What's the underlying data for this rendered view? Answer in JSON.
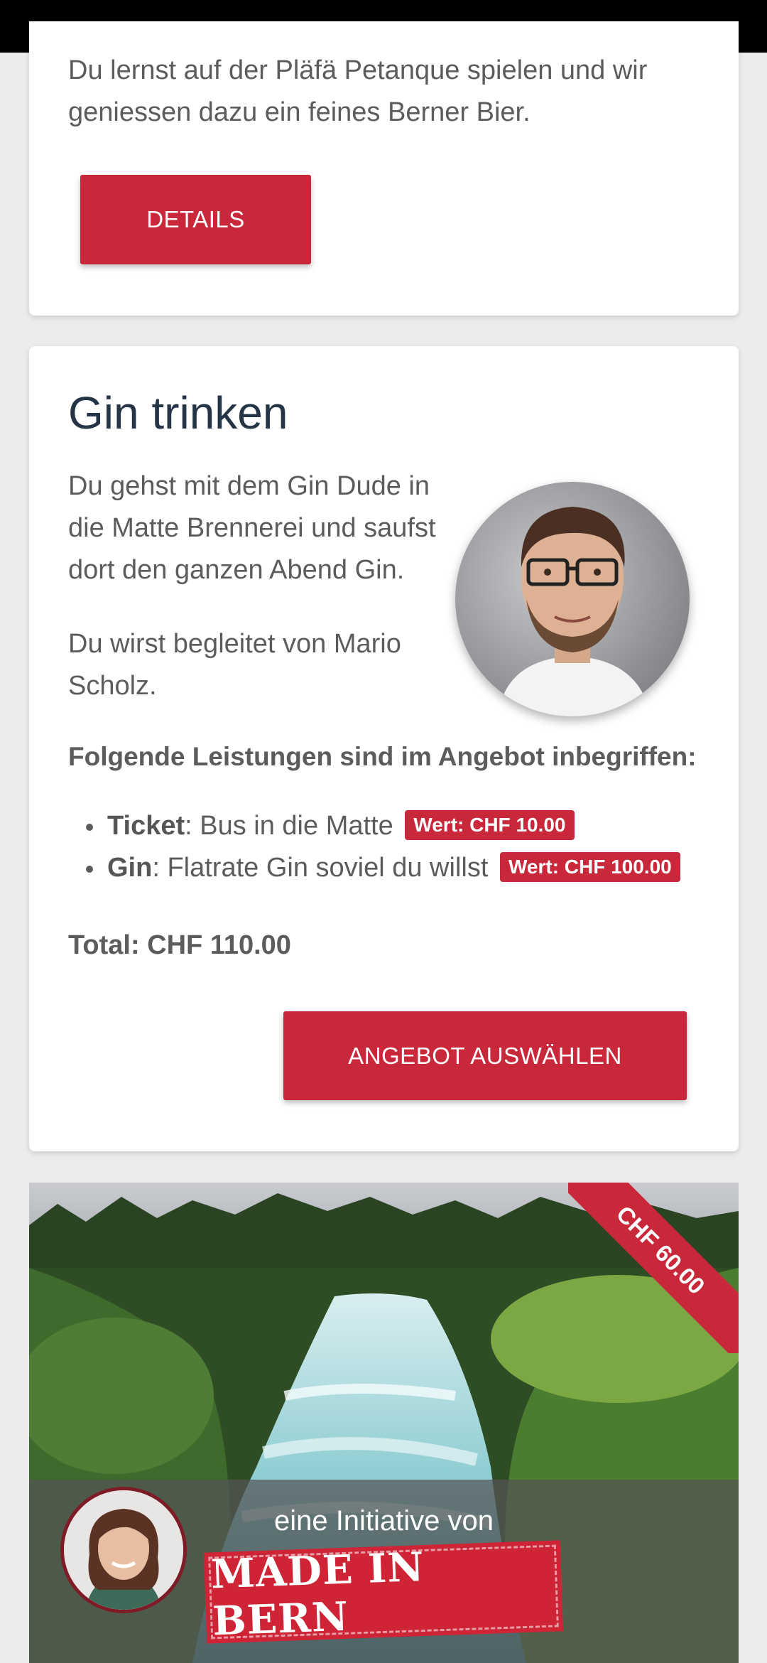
{
  "offer_prev": {
    "description": "Du lernst auf der Pläfä Petanque spielen und wir geniessen dazu ein feines Berner Bier.",
    "button_label": "DETAILS"
  },
  "offer_gin": {
    "title": "Gin trinken",
    "description": "Du gehst mit dem Gin Dude in die Matte Brennerei und saufst dort den ganzen Abend Gin.",
    "guide": "Du wirst begleitet von Mario Scholz.",
    "services_title": "Folgende Leistungen sind im Angebot inbegriffen:",
    "services": [
      {
        "name": "Ticket",
        "text": ": Bus in die Matte",
        "badge": "Wert: CHF 10.00"
      },
      {
        "name": "Gin",
        "text": ": Flatrate Gin soviel du willst",
        "badge": "Wert: CHF 100.00"
      }
    ],
    "total": "Total: CHF 110.00",
    "button_label": "ANGEBOT AUSWÄHLEN"
  },
  "offer_next": {
    "price_ribbon": "CHF 60.00"
  },
  "banner": {
    "text": "eine Initiative von",
    "brand": "MADE IN BERN"
  },
  "colors": {
    "accent": "#c9273a",
    "title": "#253447",
    "text": "#5c5c5c"
  }
}
